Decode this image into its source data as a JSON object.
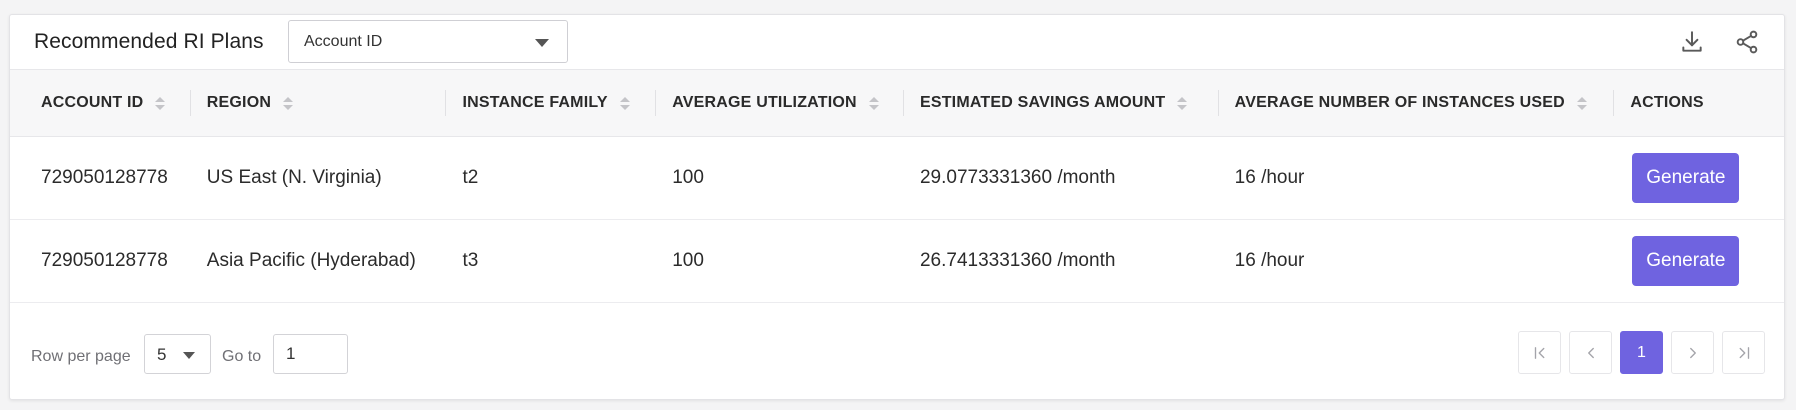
{
  "header": {
    "title": "Recommended RI Plans",
    "filter_select": {
      "value": "Account ID"
    },
    "icons": [
      "download-icon",
      "share-icon"
    ]
  },
  "table": {
    "columns": [
      "ACCOUNT ID",
      "REGION",
      "INSTANCE FAMILY",
      "AVERAGE UTILIZATION",
      "ESTIMATED SAVINGS AMOUNT",
      "AVERAGE NUMBER OF INSTANCES USED",
      "ACTIONS"
    ],
    "rows": [
      {
        "account_id": "729050128778",
        "region": "US East (N. Virginia)",
        "instance_family": "t2",
        "avg_utilization": "100",
        "savings": "29.0773331360 /month",
        "instances_used": "16 /hour",
        "action_label": "Generate"
      },
      {
        "account_id": "729050128778",
        "region": "Asia Pacific (Hyderabad)",
        "instance_family": "t3",
        "avg_utilization": "100",
        "savings": "26.7413331360 /month",
        "instances_used": "16 /hour",
        "action_label": "Generate"
      }
    ]
  },
  "footer": {
    "rows_per_page_label": "Row per page",
    "rows_per_page_value": "5",
    "goto_label": "Go to",
    "goto_value": "1",
    "current_page": "1"
  },
  "colors": {
    "accent": "#6f63e0",
    "header_bg": "#f7f7f8"
  }
}
